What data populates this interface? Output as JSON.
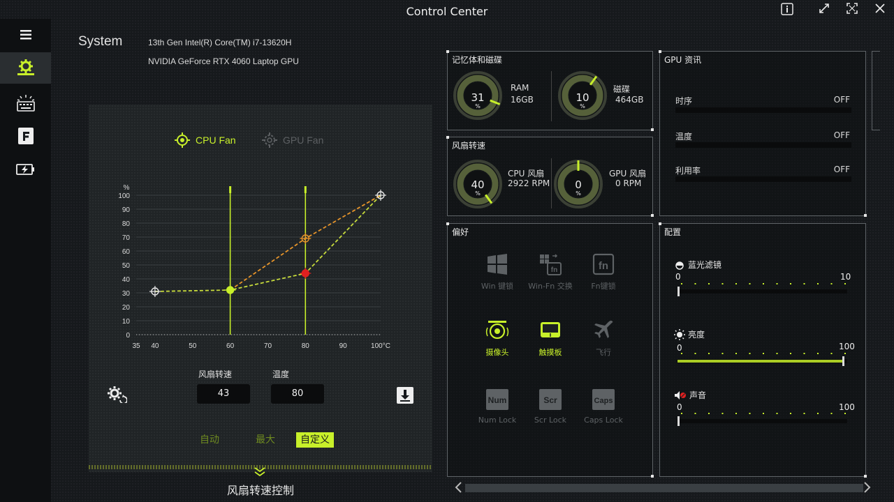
{
  "window": {
    "title": "Control Center"
  },
  "system": {
    "label": "System",
    "cpu": "13th Gen Intel(R) Core(TM) i7-13620H",
    "gpu": "NVIDIA GeForce RTX 4060 Laptop GPU"
  },
  "rail": {
    "items": [
      "menu-icon",
      "gear-icon",
      "keyboard-backlight-icon",
      "flexikey-icon",
      "battery-charge-icon"
    ]
  },
  "fan": {
    "tabs": [
      {
        "label": "CPU Fan",
        "active": true
      },
      {
        "label": "GPU Fan",
        "active": false
      }
    ],
    "speed_label": "风扇转速",
    "speed_value": "43",
    "temp_label": "温度",
    "temp_value": "80",
    "modes": [
      {
        "label": "自动",
        "active": false
      },
      {
        "label": "最大",
        "active": false
      },
      {
        "label": "自定义",
        "active": true
      }
    ],
    "footer_title": "风扇转速控制"
  },
  "chart_data": {
    "type": "line",
    "ylabel": "%",
    "xlabel": "",
    "x_ticks": [
      "35",
      "40",
      "50",
      "60",
      "70",
      "80",
      "90",
      "100°C"
    ],
    "y_ticks": [
      "0",
      "10",
      "20",
      "30",
      "40",
      "50",
      "60",
      "70",
      "80",
      "90",
      "100"
    ],
    "xlim": [
      35,
      100
    ],
    "ylim": [
      0,
      100
    ],
    "grid": true,
    "vertical_markers": [
      60,
      80
    ],
    "series": [
      {
        "color": "#c8dc3c",
        "points": [
          [
            40,
            31
          ],
          [
            60,
            32
          ],
          [
            80,
            44
          ],
          [
            100,
            100
          ]
        ]
      },
      {
        "color": "#e8952a",
        "points": [
          [
            60,
            32
          ],
          [
            80,
            69
          ],
          [
            100,
            100
          ]
        ]
      }
    ]
  },
  "memory_disk": {
    "title": "记忆体和磁碟",
    "ram": {
      "value": "31",
      "unit": "%",
      "label": "RAM",
      "size": "16GB",
      "percent": 31
    },
    "disk": {
      "value": "10",
      "unit": "%",
      "label": "磁碟",
      "size": "464GB",
      "percent": 10
    }
  },
  "fan_speed": {
    "title": "风扇转速",
    "cpu": {
      "value": "40",
      "unit": "%",
      "label": "CPU 风扇",
      "rpm": "2922 RPM",
      "percent": 40
    },
    "gpu": {
      "value": "0",
      "unit": "%",
      "label": "GPU 风扇",
      "rpm": "0 RPM",
      "percent": 0
    }
  },
  "gpu_info": {
    "title": "GPU 资讯",
    "rows": [
      {
        "label": "时序",
        "value": "OFF"
      },
      {
        "label": "温度",
        "value": "OFF"
      },
      {
        "label": "利用率",
        "value": "OFF"
      }
    ]
  },
  "preferences": {
    "title": "偏好",
    "items": [
      {
        "label": "Win 键锁",
        "icon": "windows-lock-icon",
        "active": false
      },
      {
        "label": "Win-Fn 交换",
        "icon": "win-fn-swap-icon",
        "active": false
      },
      {
        "label": "Fn键锁",
        "icon": "fn-lock-icon",
        "active": false
      },
      {
        "label": "摄像头",
        "icon": "webcam-icon",
        "active": true
      },
      {
        "label": "触摸板",
        "icon": "touchpad-icon",
        "active": true
      },
      {
        "label": "飞行",
        "icon": "airplane-icon",
        "active": false
      },
      {
        "label": "Num Lock",
        "icon": "num-lock-icon",
        "key": "Num",
        "active": false
      },
      {
        "label": "Scr Lock",
        "icon": "scroll-lock-icon",
        "key": "Scr",
        "active": false
      },
      {
        "label": "Caps Lock",
        "icon": "caps-lock-icon",
        "key": "Caps",
        "active": false
      }
    ]
  },
  "config": {
    "title": "配置",
    "sliders": [
      {
        "label": "蓝光滤镜",
        "icon": "blue-light-filter-icon",
        "min": "0",
        "max": "10",
        "value": 0,
        "max_num": 10
      },
      {
        "label": "亮度",
        "icon": "brightness-icon",
        "min": "0",
        "max": "100",
        "value": 100,
        "max_num": 100
      },
      {
        "label": "声音",
        "icon": "volume-icon",
        "min": "0",
        "max": "100",
        "value": 0,
        "max_num": 100
      }
    ]
  },
  "colors": {
    "accent": "#c8f02a",
    "accent_dim": "#8fa82a",
    "inactive": "#6b6f73",
    "orange": "#e8952a",
    "red": "#e02020"
  }
}
